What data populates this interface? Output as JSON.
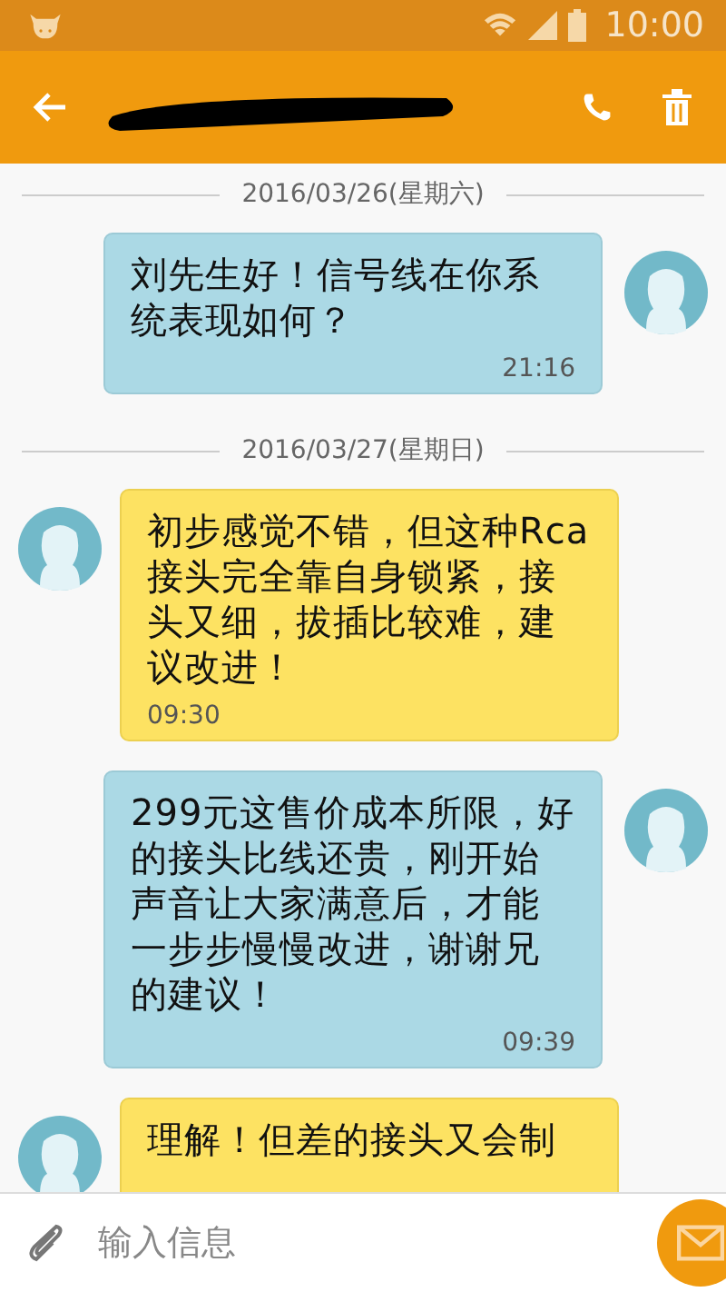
{
  "status_bar": {
    "time": "10:00"
  },
  "app_bar": {
    "contact_redacted": true
  },
  "messages": [
    {
      "kind": "date",
      "text": "2016/03/26(星期六)"
    },
    {
      "kind": "sent",
      "text": "刘先生好！信号线在你系统表现如何？",
      "time": "21:16"
    },
    {
      "kind": "date",
      "text": "2016/03/27(星期日)"
    },
    {
      "kind": "received",
      "text": "初步感觉不错，但这种Rca接头完全靠自身锁紧，接头又细，拔插比较难，建议改进！",
      "time": "09:30"
    },
    {
      "kind": "sent",
      "text": "299元这售价成本所限，好的接头比线还贵，刚开始声音让大家满意后，才能一步步慢慢改进，谢谢兄的建议！",
      "time": "09:39"
    },
    {
      "kind": "received",
      "text": "理解！但差的接头又会制"
    }
  ],
  "composer": {
    "placeholder": "输入信息"
  }
}
